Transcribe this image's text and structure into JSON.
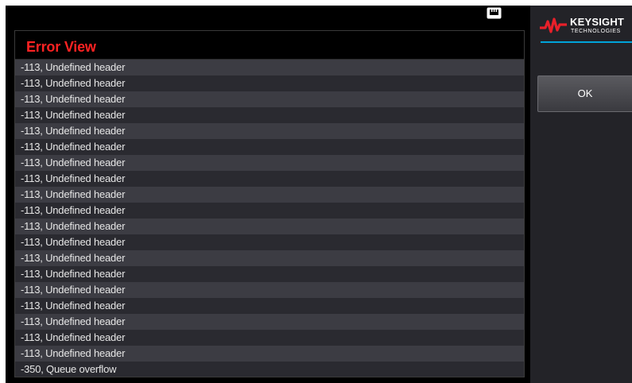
{
  "status_bar": {
    "lan_icon": "lan-icon"
  },
  "error_view": {
    "title": "Error View",
    "entries": [
      "-113, Undefined header",
      "-113, Undefined header",
      "-113, Undefined header",
      "-113, Undefined header",
      "-113, Undefined header",
      "-113, Undefined header",
      "-113, Undefined header",
      "-113, Undefined header",
      "-113, Undefined header",
      "-113, Undefined header",
      "-113, Undefined header",
      "-113, Undefined header",
      "-113, Undefined header",
      "-113, Undefined header",
      "-113, Undefined header",
      "-113, Undefined header",
      "-113, Undefined header",
      "-113, Undefined header",
      "-113, Undefined header",
      "-350, Queue overflow"
    ]
  },
  "brand": {
    "name": "KEYSIGHT",
    "subtitle": "TECHNOLOGIES",
    "logo_color": "#e8202a",
    "accent_color": "#00a3d9"
  },
  "softkeys": {
    "ok_label": "OK"
  }
}
